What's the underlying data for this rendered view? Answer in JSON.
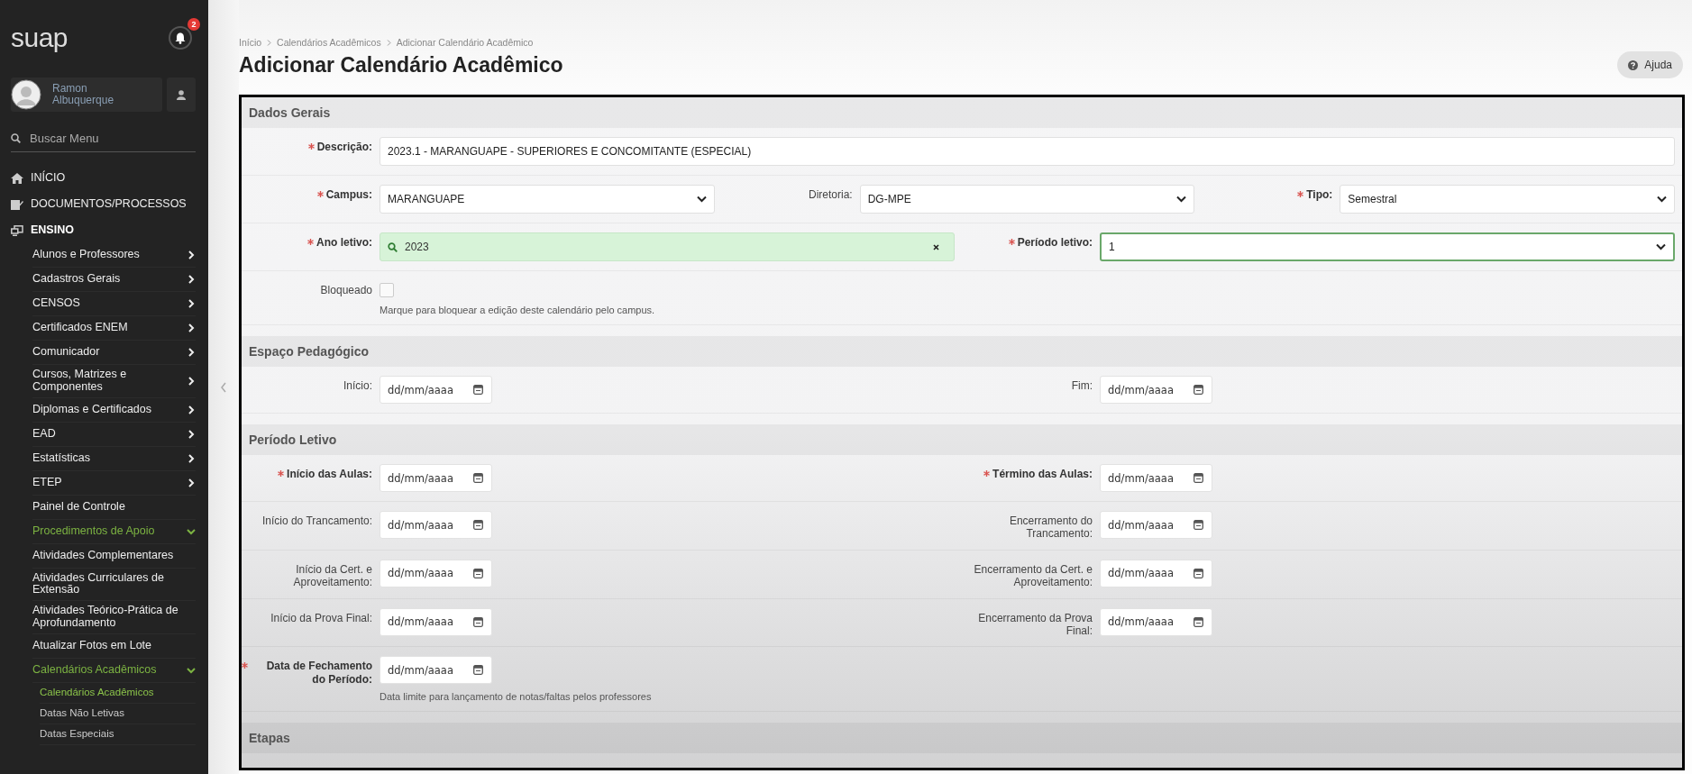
{
  "sidebar": {
    "logo": "suap",
    "notifications": "2",
    "user": {
      "name": "Ramon Albuquerque"
    },
    "search": {
      "placeholder": "Buscar Menu"
    },
    "menu": [
      {
        "label": "INÍCIO",
        "kind": "link",
        "selected": false
      },
      {
        "label": "DOCUMENTOS/PROCESSOS",
        "kind": "link",
        "selected": false
      },
      {
        "label": "ENSINO",
        "kind": "group",
        "expanded": true,
        "children": [
          {
            "label": "Alunos e Professores",
            "kind": "group",
            "expanded": false
          },
          {
            "label": "Cadastros Gerais",
            "kind": "group",
            "expanded": false
          },
          {
            "label": "CENSOS",
            "kind": "group",
            "expanded": false
          },
          {
            "label": "Certificados ENEM",
            "kind": "group",
            "expanded": false
          },
          {
            "label": "Comunicador",
            "kind": "group",
            "expanded": false
          },
          {
            "label": "Cursos, Matrizes e Componentes",
            "kind": "group",
            "expanded": false
          },
          {
            "label": "Diplomas e Certificados",
            "kind": "group",
            "expanded": false
          },
          {
            "label": "EAD",
            "kind": "group",
            "expanded": false
          },
          {
            "label": "Estatísticas",
            "kind": "group",
            "expanded": false
          },
          {
            "label": "ETEP",
            "kind": "group",
            "expanded": false
          },
          {
            "label": "Painel de Controle",
            "kind": "link",
            "selected": false
          },
          {
            "label": "Procedimentos de Apoio",
            "kind": "group",
            "expanded": true,
            "children": [
              {
                "label": "Atividades Complementares",
                "kind": "link",
                "selected": false
              },
              {
                "label": "Atividades Curriculares de Extensão",
                "kind": "link",
                "selected": false
              },
              {
                "label": "Atividades Teórico-Prática de Aprofundamento",
                "kind": "link",
                "selected": false
              },
              {
                "label": "Atualizar Fotos em Lote",
                "kind": "link",
                "selected": false
              },
              {
                "label": "Calendários Acadêmicos",
                "kind": "group",
                "expanded": true,
                "children": [
                  {
                    "label": "Calendários Acadêmicos",
                    "kind": "link",
                    "selected": true
                  },
                  {
                    "label": "Datas Não Letivas",
                    "kind": "link",
                    "selected": false
                  },
                  {
                    "label": "Datas Especiais",
                    "kind": "link",
                    "selected": false
                  }
                ]
              }
            ]
          }
        ]
      }
    ]
  },
  "breadcrumb": [
    "Início",
    "Calendários Acadêmicos",
    "Adicionar Calendário Acadêmico"
  ],
  "title": "Adicionar Calendário Acadêmico",
  "help_button": "Ajuda",
  "sections": [
    {
      "title": "Dados Gerais",
      "rows": [
        {
          "fields": [
            {
              "kind": "text",
              "label": "Descrição:",
              "required": true,
              "value": "2023.1 - MARANGUAPE - SUPERIORES E CONCOMITANTE (ESPECIAL)"
            }
          ]
        },
        {
          "fields": [
            {
              "kind": "select",
              "label": "Campus:",
              "required": true,
              "value": "MARANGUAPE",
              "focused": false
            },
            {
              "kind": "select",
              "label": "Diretoria:",
              "required": false,
              "value": "DG-MPE",
              "focused": false
            },
            {
              "kind": "select",
              "label": "Tipo:",
              "required": true,
              "value": "Semestral",
              "focused": false
            }
          ]
        },
        {
          "fields": [
            {
              "kind": "autocomplete",
              "label": "Ano letivo:",
              "required": true,
              "value": "2023"
            },
            {
              "kind": "select",
              "label": "Período letivo:",
              "required": true,
              "value": "1",
              "focused": true
            }
          ]
        },
        {
          "fields": [
            {
              "kind": "checkbox",
              "label": "Bloqueado",
              "required": false,
              "checked": false,
              "help": "Marque para bloquear a edição deste calendário pelo campus."
            }
          ]
        }
      ]
    },
    {
      "title": "Espaço Pedagógico",
      "rows": [
        {
          "fields": [
            {
              "kind": "date",
              "label": "Início:",
              "required": false,
              "placeholder": "dd/mm/aaaa"
            },
            {
              "kind": "date",
              "label": "Fim:",
              "required": false,
              "placeholder": "dd/mm/aaaa"
            }
          ]
        }
      ]
    },
    {
      "title": "Período Letivo",
      "rows": [
        {
          "fields": [
            {
              "kind": "date",
              "label": "Início das Aulas:",
              "required": true,
              "placeholder": "dd/mm/aaaa"
            },
            {
              "kind": "date",
              "label": "Término das Aulas:",
              "required": true,
              "placeholder": "dd/mm/aaaa"
            }
          ]
        },
        {
          "fields": [
            {
              "kind": "date",
              "label": "Início do Trancamento:",
              "required": false,
              "placeholder": "dd/mm/aaaa"
            },
            {
              "kind": "date",
              "label": "Encerramento do Trancamento:",
              "required": false,
              "placeholder": "dd/mm/aaaa"
            }
          ]
        },
        {
          "fields": [
            {
              "kind": "date",
              "label": "Início da Cert. e Aproveitamento:",
              "required": false,
              "placeholder": "dd/mm/aaaa"
            },
            {
              "kind": "date",
              "label": "Encerramento da Cert. e Aproveitamento:",
              "required": false,
              "placeholder": "dd/mm/aaaa"
            }
          ]
        },
        {
          "fields": [
            {
              "kind": "date",
              "label": "Início da Prova Final:",
              "required": false,
              "placeholder": "dd/mm/aaaa"
            },
            {
              "kind": "date",
              "label": "Encerramento da Prova Final:",
              "required": false,
              "placeholder": "dd/mm/aaaa"
            }
          ]
        },
        {
          "fields": [
            {
              "kind": "date",
              "label": "Data de Fechamento do Período:",
              "required": true,
              "placeholder": "dd/mm/aaaa",
              "help": "Data limite para lançamento de notas/faltas pelos professores"
            }
          ]
        }
      ]
    },
    {
      "title": "Etapas"
    }
  ]
}
